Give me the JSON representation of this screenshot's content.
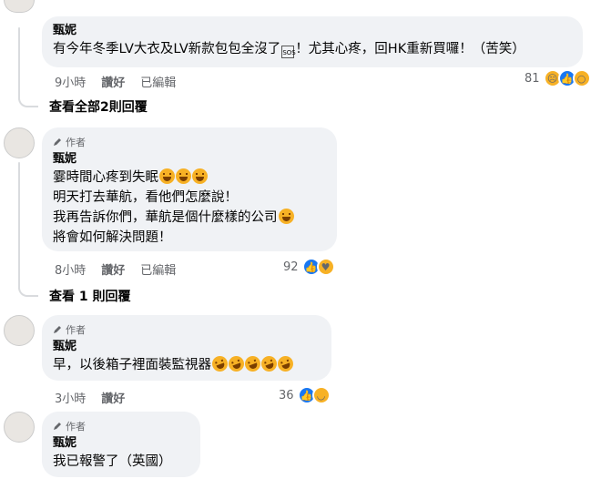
{
  "comment_top": {
    "author": "甄妮",
    "text": "有今年冬季LV大衣及LV新款包包全沒了",
    "glyph": "SOS",
    "text_after": "！尤其心疼，回HK重新買囉！（苦笑）",
    "time": "9小時",
    "like": "讚好",
    "edited": "已編輯",
    "reaction_count": "81",
    "view_replies": "查看全部2則回覆"
  },
  "comment_2": {
    "author_tag": "作者",
    "author": "甄妮",
    "lines": [
      "霎時間心疼到失眠",
      "明天打去華航，看他們怎麼說！",
      "我再告訴你們，華航是個什麼樣的公司",
      "將會如何解決問題！"
    ],
    "time": "8小時",
    "like": "讚好",
    "edited": "已編輯",
    "reaction_count": "92",
    "view_replies": "查看 1 則回覆"
  },
  "comment_3": {
    "author_tag": "作者",
    "author": "甄妮",
    "text": "早，以後箱子裡面裝監視器",
    "time": "3小時",
    "like": "讚好",
    "reaction_count": "36"
  },
  "comment_4": {
    "author_tag": "作者",
    "author": "甄妮",
    "text": "我已報警了（英國）"
  },
  "colors": {
    "bubble": "#f0f2f5",
    "like_blue": "#1877f2",
    "emoji_yellow": "#f7b125",
    "meta_gray": "#65676b"
  }
}
